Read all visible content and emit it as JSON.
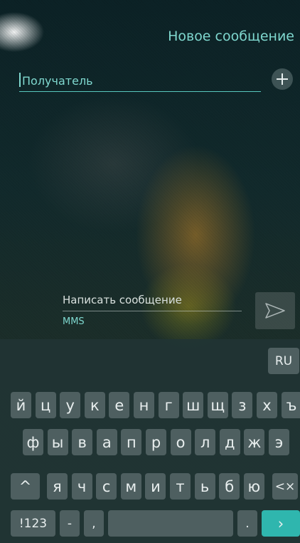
{
  "header": {
    "title": "Новое сообщение"
  },
  "recipient": {
    "placeholder": "Получатель"
  },
  "compose": {
    "placeholder": "Написать сообщение",
    "mode": "MMS"
  },
  "keyboard": {
    "language": "RU",
    "row1": [
      "й",
      "ц",
      "у",
      "к",
      "е",
      "н",
      "г",
      "ш",
      "щ",
      "з",
      "х",
      "ъ"
    ],
    "row2": [
      "ф",
      "ы",
      "в",
      "а",
      "п",
      "р",
      "о",
      "л",
      "д",
      "ж",
      "э"
    ],
    "row3": [
      "я",
      "ч",
      "с",
      "м",
      "и",
      "т",
      "ь",
      "б",
      "ю"
    ],
    "shift_label": "^",
    "backspace_label": "<×",
    "numbers_label": "!123",
    "dash_label": "-",
    "comma_label": ",",
    "period_label": ".",
    "enter_label": "›"
  },
  "colors": {
    "accent": "#7fd8cf",
    "enter": "#2fb6ae",
    "key": "#4e5f60",
    "keyboard_bg": "#213434"
  },
  "icons": {
    "add": "add-contact-icon",
    "send": "send-icon"
  }
}
